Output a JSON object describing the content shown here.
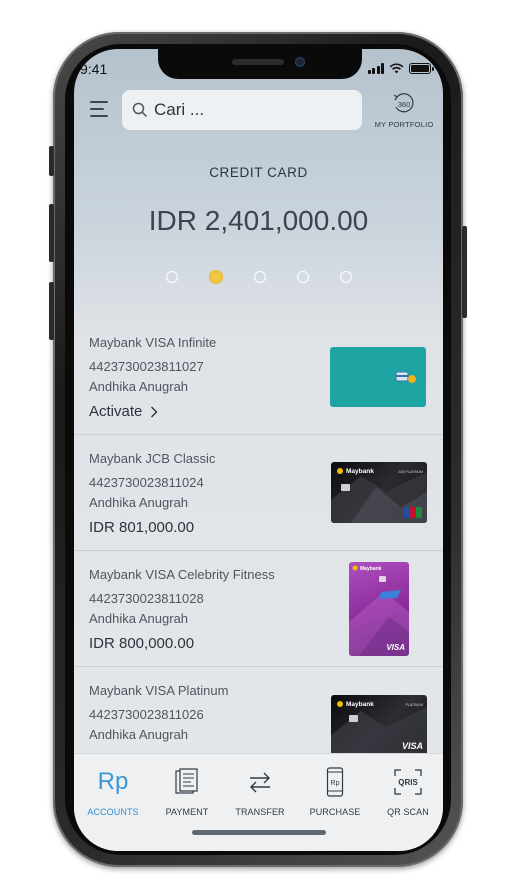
{
  "status_bar": {
    "time": "9:41"
  },
  "header": {
    "search_placeholder": "Cari ...",
    "portfolio_label": "MY PORTFOLIO",
    "portfolio_icon_text": "360"
  },
  "summary": {
    "title": "CREDIT CARD",
    "balance": "IDR 2,401,000.00",
    "page_count": 5,
    "active_page": 2
  },
  "cards": [
    {
      "name": "Maybank VISA Infinite",
      "number": "4423730023811027",
      "holder": "Andhika Anugrah",
      "action": "Activate",
      "amount": null,
      "card_color": "#1ea4a3"
    },
    {
      "name": "Maybank JCB Classic",
      "number": "4423730023811024",
      "holder": "Andhika Anugrah",
      "action": null,
      "amount": "IDR 801,000.00",
      "card_brand": "Maybank",
      "card_tier": "JCB PLATINUM"
    },
    {
      "name": "Maybank VISA Celebrity Fitness",
      "number": "4423730023811028",
      "holder": "Andhika Anugrah",
      "action": null,
      "amount": "IDR 800,000.00",
      "card_brand": "Maybank",
      "card_network": "VISA"
    },
    {
      "name": "Maybank VISA Platinum",
      "number": "4423730023811026",
      "holder": "Andhika Anugrah",
      "action": null,
      "amount": null,
      "card_brand": "Maybank",
      "card_tier": "PLATINUM",
      "card_network": "VISA"
    }
  ],
  "bottom_nav": {
    "items": [
      {
        "label": "ACCOUNTS",
        "icon": "rupiah-icon",
        "icon_text": "Rp",
        "active": true
      },
      {
        "label": "PAYMENT",
        "icon": "receipt-icon",
        "active": false
      },
      {
        "label": "TRANSFER",
        "icon": "transfer-arrows-icon",
        "active": false
      },
      {
        "label": "PURCHASE",
        "icon": "mobile-purchase-icon",
        "icon_text": "Rp",
        "active": false
      },
      {
        "label": "QR SCAN",
        "icon": "qris-scan-icon",
        "icon_text": "QRIS",
        "active": false
      }
    ]
  },
  "colors": {
    "accent_blue": "#2e8fd0",
    "active_dot": "#f3c641",
    "infinite_card": "#1ea4a3",
    "fitness_card": "#a03aa8"
  }
}
